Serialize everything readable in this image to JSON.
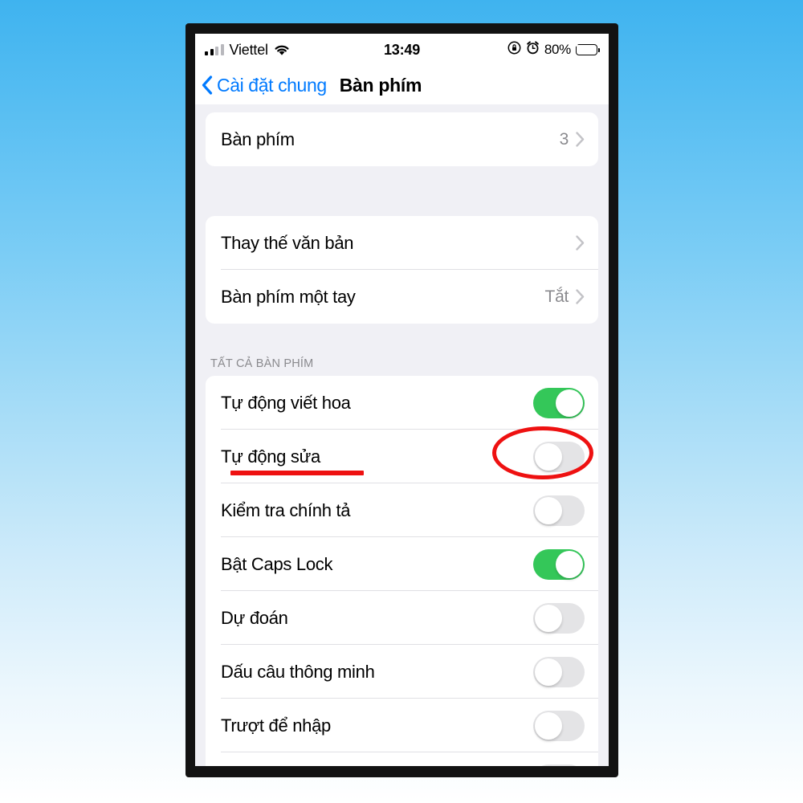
{
  "status_bar": {
    "carrier": "Viettel",
    "time": "13:49",
    "battery_percent": "80%",
    "signal_icon": "signal-bars-icon",
    "wifi_icon": "wifi-icon",
    "rotation_lock_icon": "rotation-lock-icon",
    "alarm_icon": "alarm-clock-icon",
    "battery_icon": "battery-charging-icon"
  },
  "nav_bar": {
    "back_label": "Cài đặt chung",
    "title": "Bàn phím",
    "back_icon": "chevron-left-icon"
  },
  "sections": [
    {
      "header": "",
      "rows": [
        {
          "label": "Bàn phím",
          "value": "3",
          "type": "disclosure"
        }
      ]
    },
    {
      "header": "",
      "rows": [
        {
          "label": "Thay thế văn bản",
          "value": "",
          "type": "disclosure"
        },
        {
          "label": "Bàn phím một tay",
          "value": "Tắt",
          "type": "disclosure"
        }
      ]
    },
    {
      "header": "TẤT CẢ BÀN PHÍM",
      "rows": [
        {
          "label": "Tự động viết hoa",
          "type": "toggle",
          "state": "on"
        },
        {
          "label": "Tự động sửa",
          "type": "toggle",
          "state": "off",
          "highlighted": "true"
        },
        {
          "label": "Kiểm tra chính tả",
          "type": "toggle",
          "state": "off"
        },
        {
          "label": "Bật Caps Lock",
          "type": "toggle",
          "state": "on"
        },
        {
          "label": "Dự đoán",
          "type": "toggle",
          "state": "off"
        },
        {
          "label": "Dấu câu thông minh",
          "type": "toggle",
          "state": "off"
        },
        {
          "label": "Trượt để nhập",
          "type": "toggle",
          "state": "off"
        },
        {
          "label": "",
          "type": "toggle",
          "state": "off"
        }
      ]
    }
  ],
  "annotations": {
    "underline_color": "#ee1111",
    "ellipse_color": "#ee1111",
    "underline_target": "Tự động sửa",
    "ellipse_target": "Tự động sửa toggle"
  },
  "colors": {
    "accent_blue": "#007aff",
    "toggle_on_green": "#34c759",
    "toggle_off_gray": "#e4e4e6",
    "list_background": "#f0f0f5",
    "secondary_text": "#8a8a8e"
  }
}
